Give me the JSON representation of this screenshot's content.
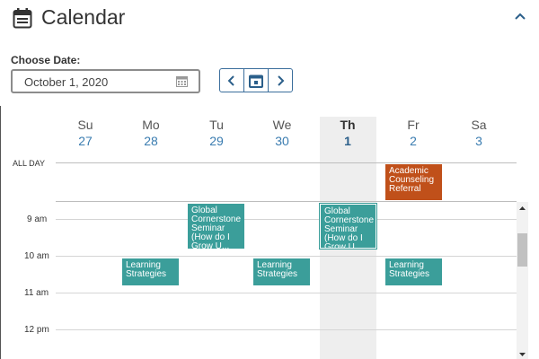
{
  "header": {
    "title": "Calendar",
    "icon": "calendar-icon"
  },
  "date_picker": {
    "label": "Choose Date:",
    "value": "October 1, 2020"
  },
  "days": [
    {
      "name": "Su",
      "num": "27"
    },
    {
      "name": "Mo",
      "num": "28"
    },
    {
      "name": "Tu",
      "num": "29"
    },
    {
      "name": "We",
      "num": "30"
    },
    {
      "name": "Th",
      "num": "1"
    },
    {
      "name": "Fr",
      "num": "2"
    },
    {
      "name": "Sa",
      "num": "3"
    }
  ],
  "all_day_label": "ALL DAY",
  "times": [
    "9 am",
    "10 am",
    "11 am",
    "12 pm"
  ],
  "events": {
    "allday_fr": "Academic Counseling Referral",
    "global_tu": "Global Cornerstone Seminar (How do I Grow U...",
    "global_th": "Global Cornerstone Seminar (How do I Grow U...",
    "learning_mo": "Learning Strategies",
    "learning_we": "Learning Strategies",
    "learning_fr": "Learning Strategies"
  },
  "colors": {
    "accent": "#3a7cb0",
    "event_teal": "#3b9e9a",
    "event_orange": "#c0501a"
  }
}
